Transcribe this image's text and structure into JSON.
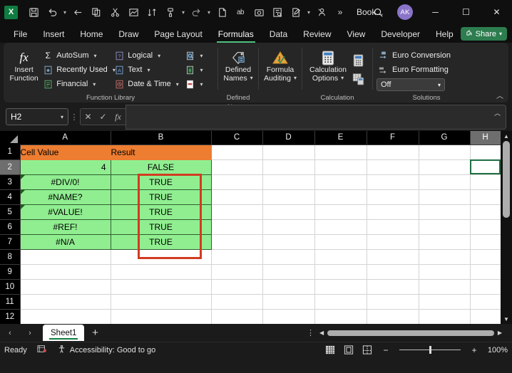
{
  "titlebar": {
    "app_name": "Excel",
    "workbook_name": "Book...",
    "avatar_initials": "AK",
    "quick_access": [
      {
        "name": "save-icon",
        "glyph": "💾"
      },
      {
        "name": "undo-icon",
        "glyph": "↶"
      },
      {
        "name": "redo-arrow-icon",
        "glyph": "←"
      },
      {
        "name": "copy-icon",
        "glyph": "❐"
      },
      {
        "name": "cut-icon",
        "glyph": "✂"
      },
      {
        "name": "chart-icon",
        "glyph": "◰"
      },
      {
        "name": "sort-icon",
        "glyph": "⇅"
      },
      {
        "name": "format-painter-icon",
        "glyph": "✎"
      },
      {
        "name": "redo-icon",
        "glyph": "↷"
      },
      {
        "name": "new-file-icon",
        "glyph": "⬚"
      },
      {
        "name": "spelling-icon",
        "glyph": "ab"
      },
      {
        "name": "camera-icon",
        "glyph": "☐"
      },
      {
        "name": "find-replace-icon",
        "glyph": "⌸"
      },
      {
        "name": "edit-document-icon",
        "glyph": "✍"
      },
      {
        "name": "person-search-icon",
        "glyph": "⚲"
      },
      {
        "name": "overflow-icon",
        "glyph": "»"
      }
    ],
    "window_controls": {
      "minimize": "─",
      "maximize": "☐",
      "close": "✕"
    }
  },
  "ribbon": {
    "tabs": [
      {
        "label": "File",
        "active": false
      },
      {
        "label": "Insert",
        "active": false
      },
      {
        "label": "Home",
        "active": false
      },
      {
        "label": "Draw",
        "active": false
      },
      {
        "label": "Page Layout",
        "active": false
      },
      {
        "label": "Formulas",
        "active": true
      },
      {
        "label": "Data",
        "active": false
      },
      {
        "label": "Review",
        "active": false
      },
      {
        "label": "View",
        "active": false
      },
      {
        "label": "Developer",
        "active": false
      },
      {
        "label": "Help",
        "active": false
      }
    ],
    "share_label": "Share",
    "groups": {
      "function_library": {
        "label": "Function Library",
        "insert_function": {
          "line1": "Insert",
          "line2": "Function",
          "icon": "fx"
        },
        "column1": [
          {
            "label": "AutoSum",
            "icon": "sigma-icon",
            "caret": true
          },
          {
            "label": "Recently Used",
            "icon": "recently-used-icon",
            "caret": true
          },
          {
            "label": "Financial",
            "icon": "financial-icon",
            "caret": true
          }
        ],
        "column2": [
          {
            "label": "Logical",
            "icon": "logical-icon",
            "caret": true
          },
          {
            "label": "Text",
            "icon": "text-icon",
            "caret": true
          },
          {
            "label": "Date & Time",
            "icon": "date-time-icon",
            "caret": true
          }
        ],
        "column3": [
          {
            "label": "",
            "icon": "lookup-reference-icon",
            "caret": true,
            "color": "#4a7aa8"
          },
          {
            "label": "",
            "icon": "math-trig-icon",
            "caret": true,
            "color": "#3f8f4f"
          },
          {
            "label": "",
            "icon": "more-functions-icon",
            "caret": true,
            "color": "#b04b4b"
          }
        ]
      },
      "defined_names": {
        "label": "Defined Names",
        "button": {
          "line1": "Defined",
          "line2": "Names"
        }
      },
      "formula_auditing": {
        "label": "",
        "button": {
          "line1": "Formula",
          "line2": "Auditing"
        }
      },
      "calculation": {
        "label": "Calculation",
        "button": {
          "line1": "Calculation",
          "line2": "Options"
        },
        "small": [
          {
            "name": "calculate-now-icon"
          },
          {
            "name": "calculate-sheet-icon"
          }
        ]
      },
      "solutions": {
        "label": "Solutions",
        "items": [
          {
            "label": "Euro Conversion",
            "icon": "euro-conversion-icon"
          },
          {
            "label": "Euro Formatting",
            "icon": "euro-formatting-icon"
          }
        ],
        "select_value": "Off"
      }
    }
  },
  "formula_bar": {
    "name_box_value": "H2",
    "cancel_icon": "✕",
    "enter_icon": "✓",
    "function_icon": "fx",
    "formula_value": ""
  },
  "sheet": {
    "columns": [
      "A",
      "B",
      "C",
      "D",
      "E",
      "F",
      "G",
      "H"
    ],
    "selected_column": "H",
    "rows": [
      "1",
      "2",
      "3",
      "4",
      "5",
      "6",
      "7",
      "8",
      "9",
      "10",
      "11",
      "12"
    ],
    "selected_row": "2",
    "selected_cell": "H2",
    "data": [
      {
        "row": "1",
        "A": "Cell Value",
        "B": "Result",
        "style": "header",
        "err": false
      },
      {
        "row": "2",
        "A": "4",
        "B": "FALSE",
        "style": "data",
        "err": false,
        "a_align": "right"
      },
      {
        "row": "3",
        "A": "#DIV/0!",
        "B": "TRUE",
        "style": "data",
        "err": true
      },
      {
        "row": "4",
        "A": "#NAME?",
        "B": "TRUE",
        "style": "data",
        "err": true
      },
      {
        "row": "5",
        "A": "#VALUE!",
        "B": "TRUE",
        "style": "data",
        "err": true
      },
      {
        "row": "6",
        "A": "#REF!",
        "B": "TRUE",
        "style": "data",
        "err": false
      },
      {
        "row": "7",
        "A": "#N/A",
        "B": "TRUE",
        "style": "data",
        "err": false
      },
      {
        "row": "8",
        "A": "",
        "B": "",
        "style": "empty",
        "err": false
      },
      {
        "row": "9",
        "A": "",
        "B": "",
        "style": "empty",
        "err": false
      },
      {
        "row": "10",
        "A": "",
        "B": "",
        "style": "empty",
        "err": false
      },
      {
        "row": "11",
        "A": "",
        "B": "",
        "style": "empty",
        "err": false
      },
      {
        "row": "12",
        "A": "",
        "B": "",
        "style": "empty",
        "err": false
      }
    ],
    "colors": {
      "header_fill": "#ED7D31",
      "data_fill": "#90EE90",
      "annotation": "#d13b20",
      "selection": "#1f6f43"
    }
  },
  "sheet_tabs": {
    "prev_icon": "‹",
    "next_icon": "›",
    "tabs": [
      {
        "label": "Sheet1",
        "active": true
      }
    ],
    "add_label": "+"
  },
  "status_bar": {
    "mode": "Ready",
    "accessibility": "Accessibility: Good to go",
    "views": [
      {
        "name": "normal-view-icon"
      },
      {
        "name": "page-layout-view-icon"
      },
      {
        "name": "page-break-view-icon"
      }
    ],
    "zoom_out": "−",
    "zoom_in": "+",
    "zoom_level": "100%"
  }
}
